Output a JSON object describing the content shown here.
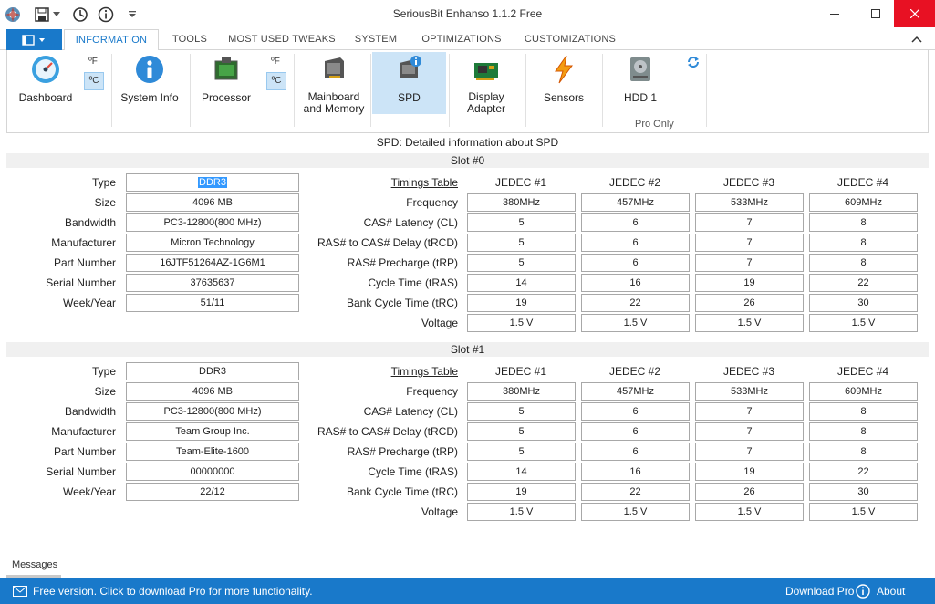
{
  "app": {
    "title": "SeriousBit Enhanso 1.1.2 Free"
  },
  "tabs": [
    "INFORMATION",
    "TOOLS",
    "MOST USED TWEAKS",
    "SYSTEM",
    "OPTIMIZATIONS",
    "CUSTOMIZATIONS"
  ],
  "ribbon": {
    "buttons": [
      {
        "label": "Dashboard"
      },
      {
        "label": "System Info"
      },
      {
        "label": "Processor"
      },
      {
        "label": "Mainboard\nand Memory"
      },
      {
        "label": "SPD"
      },
      {
        "label": "Display\nAdapter"
      },
      {
        "label": "Sensors"
      },
      {
        "label": "HDD 1"
      }
    ],
    "unit_f": "ºF",
    "unit_c": "ºC",
    "pro_only": "Pro Only"
  },
  "content": {
    "caption": "SPD: Detailed information about SPD",
    "left_labels": [
      "Type",
      "Size",
      "Bandwidth",
      "Manufacturer",
      "Part Number",
      "Serial Number",
      "Week/Year"
    ],
    "timing_labels": [
      "Frequency",
      "CAS# Latency (CL)",
      "RAS# to CAS# Delay (tRCD)",
      "RAS# Precharge (tRP)",
      "Cycle Time (tRAS)",
      "Bank Cycle Time (tRC)",
      "Voltage"
    ],
    "timings_table_label": "Timings Table",
    "jedec_headers": [
      "JEDEC #1",
      "JEDEC #2",
      "JEDEC #3",
      "JEDEC #4"
    ],
    "slots": [
      {
        "name": "Slot #0",
        "info": [
          "DDR3",
          "4096 MB",
          "PC3-12800(800 MHz)",
          "Micron Technology",
          "16JTF51264AZ-1G6M1",
          "37635637",
          "51/11"
        ],
        "timings": [
          [
            "380MHz",
            "457MHz",
            "533MHz",
            "609MHz"
          ],
          [
            "5",
            "6",
            "7",
            "8"
          ],
          [
            "5",
            "6",
            "7",
            "8"
          ],
          [
            "5",
            "6",
            "7",
            "8"
          ],
          [
            "14",
            "16",
            "19",
            "22"
          ],
          [
            "19",
            "22",
            "26",
            "30"
          ],
          [
            "1.5 V",
            "1.5 V",
            "1.5 V",
            "1.5 V"
          ]
        ]
      },
      {
        "name": "Slot #1",
        "info": [
          "DDR3",
          "4096 MB",
          "PC3-12800(800 MHz)",
          "Team Group Inc.",
          "Team-Elite-1600",
          "00000000",
          "22/12"
        ],
        "timings": [
          [
            "380MHz",
            "457MHz",
            "533MHz",
            "609MHz"
          ],
          [
            "5",
            "6",
            "7",
            "8"
          ],
          [
            "5",
            "6",
            "7",
            "8"
          ],
          [
            "5",
            "6",
            "7",
            "8"
          ],
          [
            "14",
            "16",
            "19",
            "22"
          ],
          [
            "19",
            "22",
            "26",
            "30"
          ],
          [
            "1.5 V",
            "1.5 V",
            "1.5 V",
            "1.5 V"
          ]
        ]
      }
    ]
  },
  "messages_tab": "Messages",
  "statusbar": {
    "message": "Free version. Click to download Pro for more functionality.",
    "download_pro": "Download Pro",
    "about": "About"
  },
  "colors": {
    "accent": "#1979ca",
    "selected": "#cce4f7",
    "close": "#e81123"
  }
}
